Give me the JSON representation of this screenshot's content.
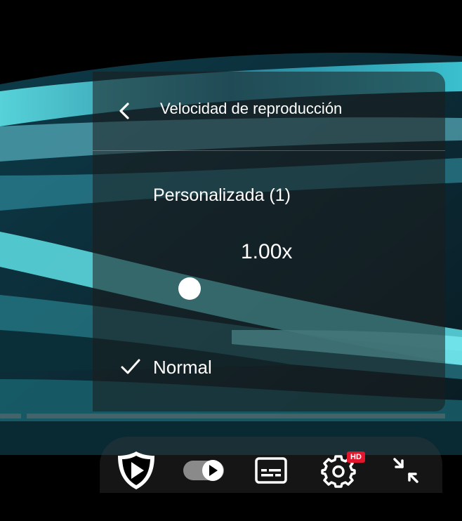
{
  "menu": {
    "title": "Velocidad de reproducción",
    "back_icon": "chevron-left-icon",
    "custom_label": "Personalizada (1)",
    "speed_value": "1.00x",
    "slider_level": 0.0,
    "options": [
      {
        "label": "Normal",
        "selected": true
      }
    ]
  },
  "controls": {
    "items": [
      {
        "icon": "shield-play-icon"
      },
      {
        "icon": "autoplay-toggle-icon",
        "state": "on"
      },
      {
        "icon": "subtitles-icon"
      },
      {
        "icon": "settings-gear-icon",
        "badge": "HD"
      },
      {
        "icon": "exit-fullscreen-icon"
      }
    ]
  },
  "colors": {
    "panel_bg": "#1c1c1c",
    "accent_badge": "#e2162d",
    "text": "#ffffff"
  }
}
